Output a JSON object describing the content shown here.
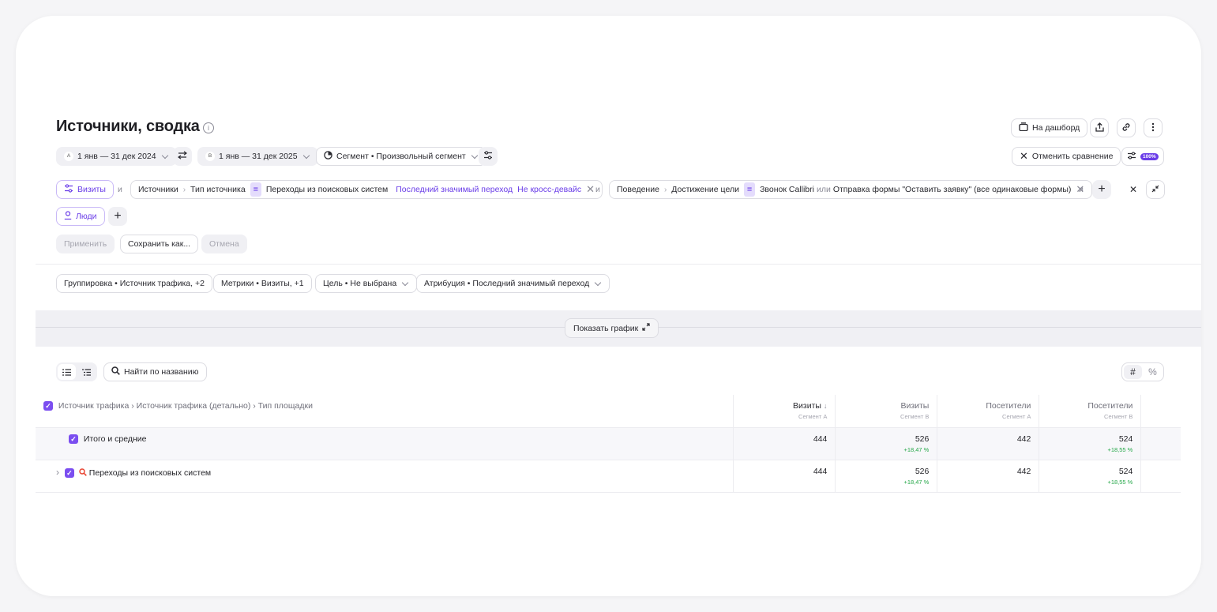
{
  "page": {
    "title": "Источники, сводка",
    "info_glyph": "i"
  },
  "header_actions": {
    "dashboard_label": "На дашборд",
    "cancel_compare_label": "Отменить сравнение",
    "sampling_badge": "100%"
  },
  "dates": {
    "segment_a_badge": "A",
    "segment_a_range": "1 янв — 31 дек 2024",
    "segment_b_badge": "B",
    "segment_b_range": "1 янв — 31 дек 2025",
    "segment_label": "Сегмент • Произвольный сегмент"
  },
  "filters": {
    "visits_chip": "Визиты",
    "and": "и",
    "condition1": {
      "part1": "Источники",
      "part2": "Тип источника",
      "op": "=",
      "value": "Переходы из поисковых систем",
      "attribution": "Последний значимый переход",
      "cross_device": "Не кросс-девайс"
    },
    "condition2": {
      "part1": "Поведение",
      "part2": "Достижение цели",
      "op": "=",
      "value1": "Звонок Callibri",
      "or": "или",
      "value2": "Отправка формы \"Оставить заявку\" (все одинаковые формы)"
    },
    "people_chip": "Люди"
  },
  "form_actions": {
    "apply": "Применить",
    "save_as": "Сохранить как...",
    "cancel": "Отмена"
  },
  "report_settings": {
    "grouping": "Группировка • Источник трафика, +2",
    "metrics": "Метрики • Визиты, +1",
    "goal": "Цель • Не выбрана",
    "attribution": "Атрибуция • Последний значимый переход"
  },
  "graph": {
    "show_label": "Показать график"
  },
  "table_tools": {
    "search_label": "Найти по названию",
    "format_abs": "#",
    "format_pct": "%"
  },
  "table": {
    "dimension_header": "Источник трафика › Источник трафика (детально) › Тип площадки",
    "columns": [
      {
        "name": "Визиты",
        "segment": "Сегмент A",
        "sort": "↓"
      },
      {
        "name": "Визиты",
        "segment": "Сегмент B"
      },
      {
        "name": "Посетители",
        "segment": "Сегмент A"
      },
      {
        "name": "Посетители",
        "segment": "Сегмент B"
      }
    ],
    "total_row": {
      "label": "Итого и средние",
      "visits_a": "444",
      "visits_b": "526",
      "visits_b_delta": "+18,47 %",
      "visitors_a": "442",
      "visitors_b": "524",
      "visitors_b_delta": "+18,55 %"
    },
    "rows": [
      {
        "label": "Переходы из поисковых систем",
        "visits_a": "444",
        "visits_b": "526",
        "visits_b_delta": "+18,47 %",
        "visitors_a": "442",
        "visitors_b": "524",
        "visitors_b_delta": "+18,55 %"
      }
    ]
  },
  "colors": {
    "accent": "#6a3de8",
    "positive": "#27a84a",
    "search_icon": "#e8402d"
  }
}
